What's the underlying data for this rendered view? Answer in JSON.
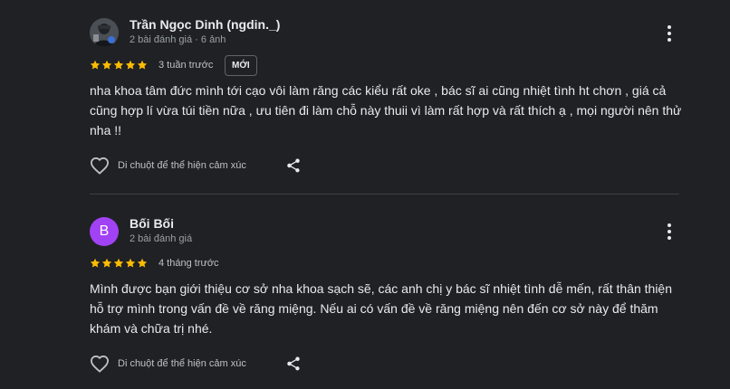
{
  "colors": {
    "background": "#202124",
    "star": "#fbbc04",
    "avatar_letter_bg": "#a142f4"
  },
  "reviews": [
    {
      "avatar": {
        "type": "photo",
        "icon": "profile-photo"
      },
      "name": "Trần Ngọc Dinh (ngdin._)",
      "meta": "2 bài đánh giá · 6 ảnh",
      "rating": 5,
      "time": "3 tuần trước",
      "badge": "MỚI",
      "text": "nha khoa tâm đức mình tới cạo vôi làm răng các kiểu rất oke , bác sĩ ai cũng nhiệt tình ht chơn , giá cả cũng hợp lí vừa túi tiền nữa , ưu tiên đi làm chỗ này thuii vì làm rất hợp và rất thích ạ , mọi người nên thử nha !!",
      "like_label": "Di chuột để thể hiện cảm xúc"
    },
    {
      "avatar": {
        "type": "letter",
        "letter": "B"
      },
      "name": "Bối Bối",
      "meta": "2 bài đánh giá",
      "rating": 5,
      "time": "4 tháng trước",
      "text": "Mình được bạn giới thiệu cơ sở nha khoa sạch sẽ, các anh chị y bác sĩ nhiệt tình dễ mến, rất thân thiện hỗ trợ mình trong vấn đề về răng miệng. Nếu ai có vấn đề về răng miệng nên đến cơ sở này để thăm khám và chữa trị nhé.",
      "like_label": "Di chuột để thể hiện cảm xúc"
    }
  ]
}
